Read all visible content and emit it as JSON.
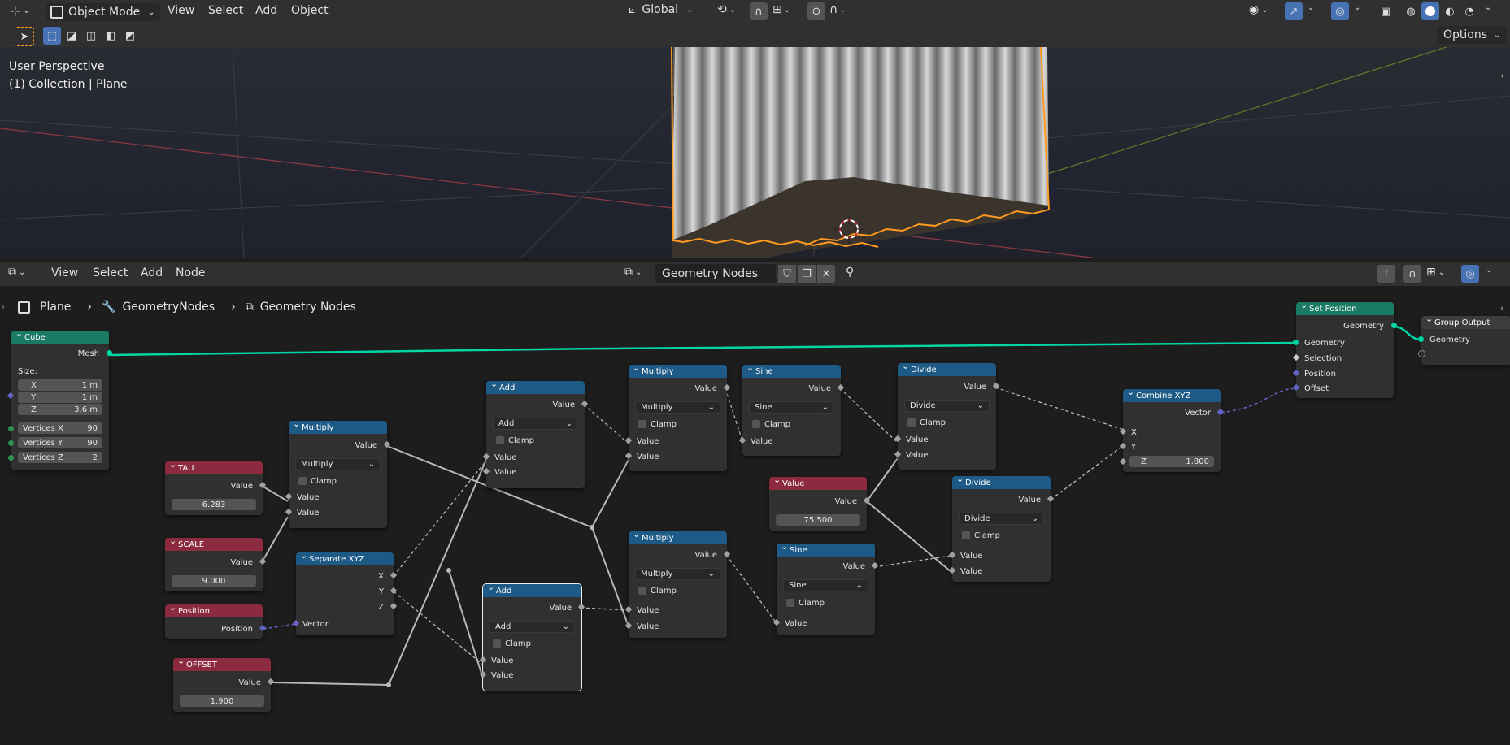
{
  "top_header": {
    "mode": "Object Mode",
    "menu": [
      "View",
      "Select",
      "Add",
      "Object"
    ],
    "transform_orientation": "Global",
    "options": "Options"
  },
  "viewport": {
    "perspective": "User Perspective",
    "collection": "(1) Collection | Plane"
  },
  "node_header": {
    "menu": [
      "View",
      "Select",
      "Add",
      "Node"
    ],
    "tree_name": "Geometry Nodes"
  },
  "breadcrumb": [
    "Plane",
    "GeometryNodes",
    "Geometry Nodes"
  ],
  "nodes": {
    "cube": {
      "title": "Cube",
      "mesh": "Mesh",
      "size": "Size:",
      "x_label": "X",
      "x": "1 m",
      "y_label": "Y",
      "y": "1 m",
      "z_label": "Z",
      "z": "3.6 m",
      "vx_label": "Vertices X",
      "vx": "90",
      "vy_label": "Vertices Y",
      "vy": "90",
      "vz_label": "Vertices Z",
      "vz": "2"
    },
    "tau": {
      "title": "TAU",
      "out": "Value",
      "value": "6.283"
    },
    "scale": {
      "title": "SCALE",
      "out": "Value",
      "value": "9.000"
    },
    "position": {
      "title": "Position",
      "out": "Position"
    },
    "offset": {
      "title": "OFFSET",
      "out": "Value",
      "value": "1.900"
    },
    "multiply1": {
      "title": "Multiply",
      "out": "Value",
      "op": "Multiply",
      "clamp": "Clamp",
      "in1": "Value",
      "in2": "Value"
    },
    "separate": {
      "title": "Separate XYZ",
      "x": "X",
      "y": "Y",
      "z": "Z",
      "in": "Vector"
    },
    "add1": {
      "title": "Add",
      "out": "Value",
      "op": "Add",
      "clamp": "Clamp",
      "in1": "Value",
      "in2": "Value"
    },
    "add2": {
      "title": "Add",
      "out": "Value",
      "op": "Add",
      "clamp": "Clamp",
      "in1": "Value",
      "in2": "Value"
    },
    "multiply2": {
      "title": "Multiply",
      "out": "Value",
      "op": "Multiply",
      "clamp": "Clamp",
      "in1": "Value",
      "in2": "Value"
    },
    "multiply3": {
      "title": "Multiply",
      "out": "Value",
      "op": "Multiply",
      "clamp": "Clamp",
      "in1": "Value",
      "in2": "Value"
    },
    "sine1": {
      "title": "Sine",
      "out": "Value",
      "op": "Sine",
      "clamp": "Clamp",
      "in1": "Value"
    },
    "sine2": {
      "title": "Sine",
      "out": "Value",
      "op": "Sine",
      "clamp": "Clamp",
      "in1": "Value"
    },
    "value": {
      "title": "Value",
      "out": "Value",
      "value": "75.500"
    },
    "divide1": {
      "title": "Divide",
      "out": "Value",
      "op": "Divide",
      "clamp": "Clamp",
      "in1": "Value",
      "in2": "Value"
    },
    "divide2": {
      "title": "Divide",
      "out": "Value",
      "op": "Divide",
      "clamp": "Clamp",
      "in1": "Value",
      "in2": "Value"
    },
    "combine": {
      "title": "Combine XYZ",
      "out": "Vector",
      "x": "X",
      "y": "Y",
      "z_label": "Z",
      "z": "1.800"
    },
    "set_position": {
      "title": "Set Position",
      "out": "Geometry",
      "in_geo": "Geometry",
      "selection": "Selection",
      "position": "Position",
      "offset": "Offset"
    },
    "group_output": {
      "title": "Group Output",
      "in_geo": "Geometry"
    }
  },
  "colors": {
    "geometry_link": "#00d6a3",
    "accent": "#4772b3",
    "selection_outline": "#ff9a1f"
  }
}
